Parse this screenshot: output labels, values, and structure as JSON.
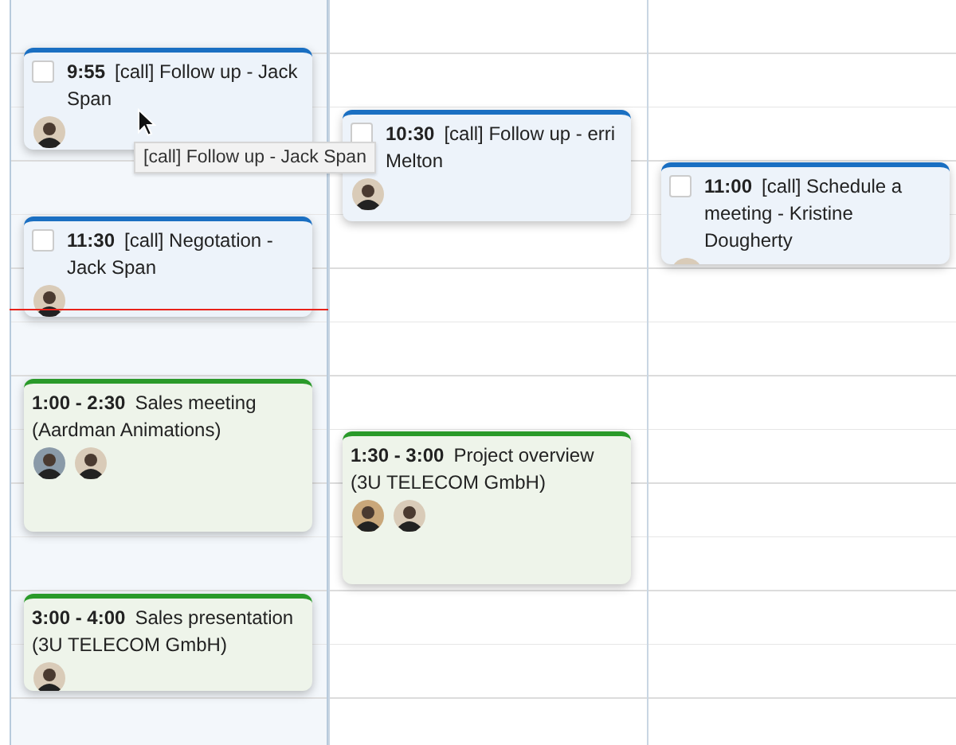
{
  "calendar": {
    "days": [
      {
        "today": true,
        "events": [
          {
            "kind": "task",
            "checked": false,
            "time": "9:55",
            "title": "[call] Follow up - Jack Span",
            "attendees": [
              {
                "color": "#d9cbb8"
              }
            ]
          },
          {
            "kind": "task",
            "checked": false,
            "time": "11:30",
            "title": "[call] Negotation - Jack Span",
            "attendees": [
              {
                "color": "#d9cbb8"
              }
            ]
          },
          {
            "kind": "meeting",
            "time": "1:00 - 2:30",
            "title": "Sales meeting (Aardman Animations)",
            "attendees": [
              {
                "color": "#8a9aa8"
              },
              {
                "color": "#d9cbb8"
              }
            ]
          },
          {
            "kind": "meeting",
            "time": "3:00 - 4:00",
            "title": "Sales presentation (3U TELECOM GmbH)",
            "attendees": [
              {
                "color": "#d9cbb8"
              }
            ]
          }
        ]
      },
      {
        "today": false,
        "events": [
          {
            "kind": "task",
            "checked": false,
            "time": "10:30",
            "title": "[call] Follow up - erri Melton",
            "attendees": [
              {
                "color": "#d9cbb8"
              }
            ]
          },
          {
            "kind": "meeting",
            "time": "1:30 - 3:00",
            "title": "Project overview (3U TELECOM GmbH)",
            "attendees": [
              {
                "color": "#c9a77a"
              },
              {
                "color": "#d9cbb8"
              }
            ]
          }
        ]
      },
      {
        "today": false,
        "events": [
          {
            "kind": "task",
            "checked": false,
            "time": "11:00",
            "title": "[call] Schedule a meeting - Kristine Dougherty",
            "attendees": [
              {
                "color": "#d9cbb8"
              }
            ]
          }
        ]
      }
    ]
  },
  "tooltip": {
    "text": "[call] Follow up - Jack Span"
  }
}
